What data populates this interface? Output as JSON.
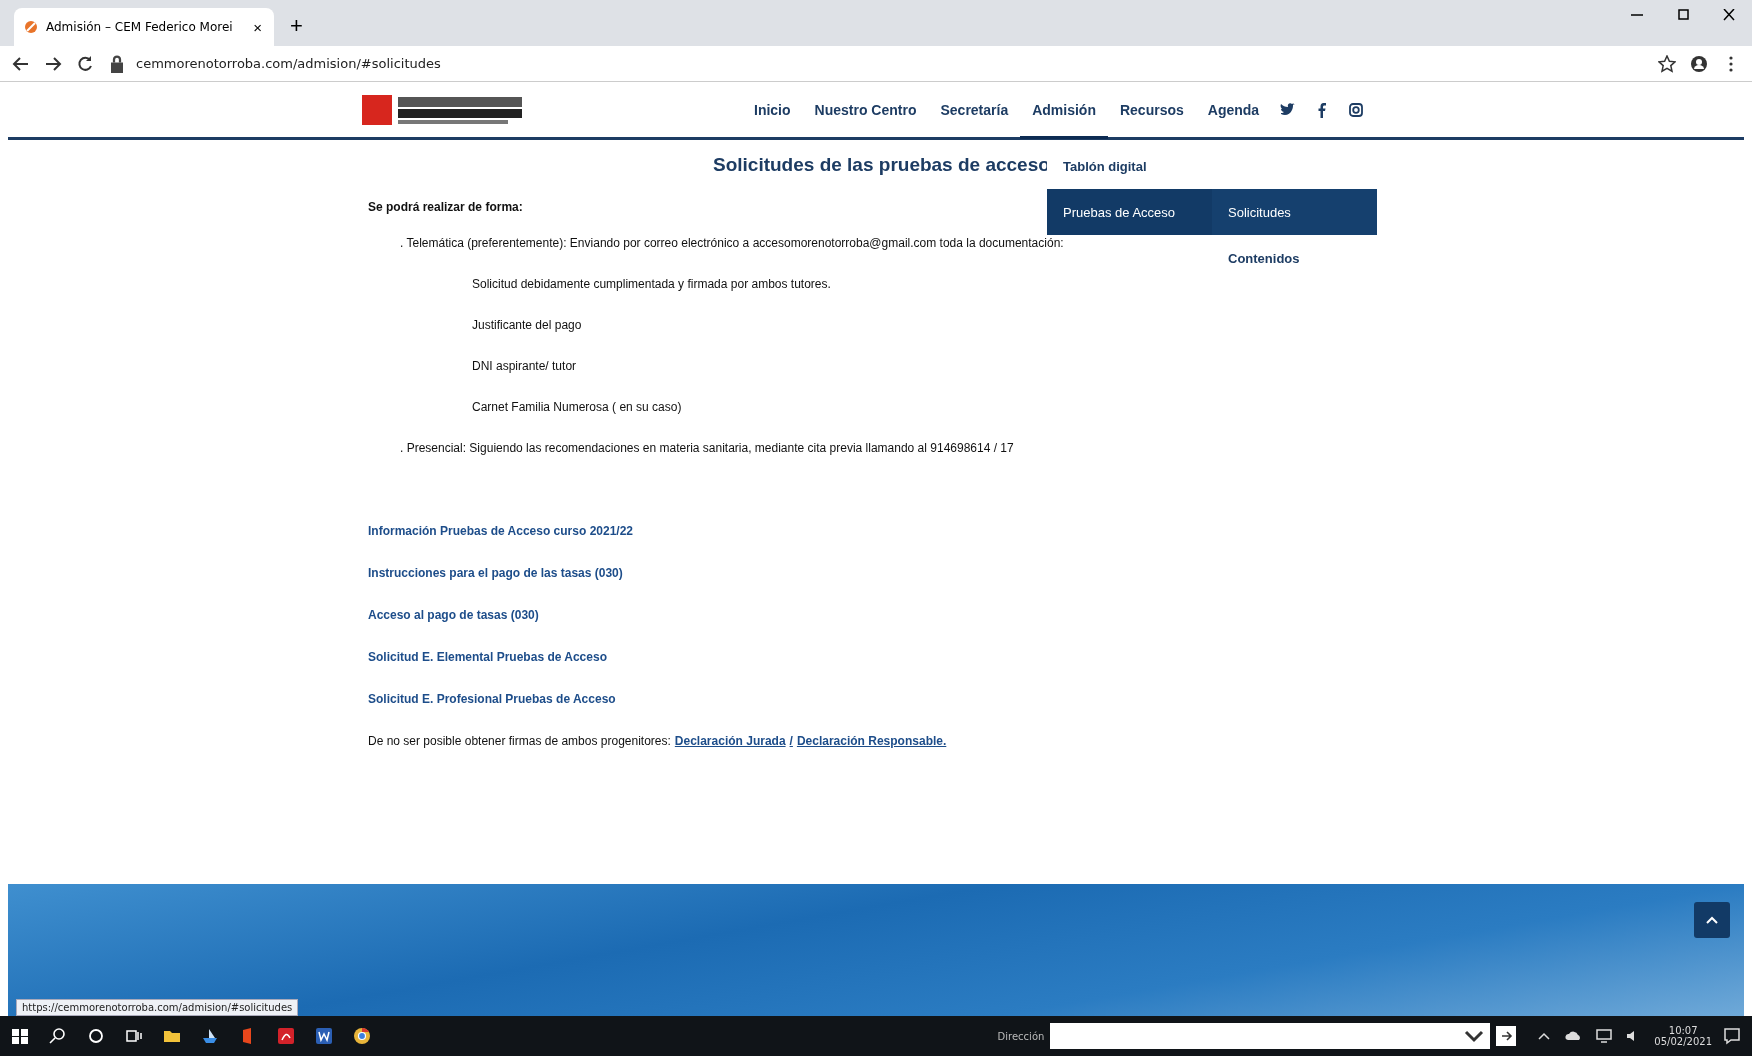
{
  "browser": {
    "tab_title": "Admisión – CEM Federico Morei",
    "tab_close": "×",
    "new_tab": "+",
    "url": "cemmorenotorroba.com/admision/#solicitudes"
  },
  "site_nav": {
    "items": [
      {
        "label": "Inicio",
        "selected": false
      },
      {
        "label": "Nuestro Centro",
        "selected": false
      },
      {
        "label": "Secretaría",
        "selected": false
      },
      {
        "label": "Admisión",
        "selected": true
      },
      {
        "label": "Recursos",
        "selected": false
      },
      {
        "label": "Agenda",
        "selected": false
      }
    ],
    "dropdown": [
      {
        "label": "Tablón digital",
        "selected": false
      },
      {
        "label": "Pruebas de Acceso",
        "selected": true,
        "children": [
          {
            "label": "Solicitudes",
            "selected": true
          },
          {
            "label": "Contenidos",
            "selected": false
          }
        ]
      }
    ]
  },
  "content": {
    "title": "Solicitudes de las pruebas de acceso",
    "intro": "Se podrá realizar de forma:",
    "lines": [
      {
        "kind": "option",
        "text": ". Telemática (preferentemente): Enviando por correo electrónico a accesomorenotorroba@gmail.com toda la documentación:"
      },
      {
        "kind": "item",
        "text": "Solicitud debidamente cumplimentada y firmada por ambos tutores."
      },
      {
        "kind": "item",
        "text": "Justificante del pago"
      },
      {
        "kind": "item",
        "text": "DNI aspirante/ tutor"
      },
      {
        "kind": "item",
        "text": "Carnet Familia Numerosa ( en su caso)"
      },
      {
        "kind": "option",
        "text": ". Presencial: Siguiendo las recomendaciones en materia sanitaria, mediante cita previa llamando al 914698614 / 17"
      }
    ],
    "links": [
      "Información Pruebas de Acceso curso 2021/22",
      "Instrucciones para el pago de las tasas (030)",
      "Acceso al pago de tasas (030)",
      "Solicitud E. Elemental Pruebas de Acceso",
      "Solicitud E. Profesional Pruebas de Acceso"
    ],
    "note": {
      "text": "De no ser posible obtener firmas de ambos progenitores:",
      "links": [
        "Declaración Jurada",
        "/",
        "Declaración Responsable."
      ]
    }
  },
  "status_url": "https://cemmorenotorroba.com/admision/#solicitudes",
  "taskbar": {
    "address_label": "Dirección",
    "time": "10:07",
    "date": "05/02/2021"
  }
}
